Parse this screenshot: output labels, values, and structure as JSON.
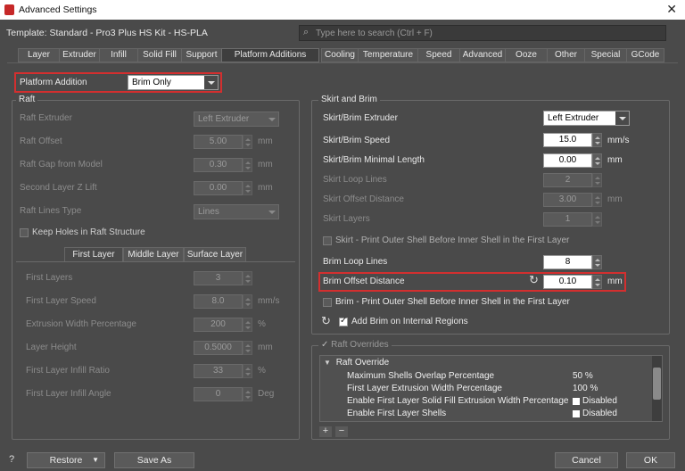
{
  "window": {
    "title": "Advanced Settings",
    "close_icon": "close-icon"
  },
  "header": {
    "template": "Template: Standard - Pro3 Plus HS Kit - HS-PLA",
    "search_placeholder": "Type here to search (Ctrl + F)"
  },
  "tabs": [
    "Layer",
    "Extruder",
    "Infill",
    "Solid Fill",
    "Support",
    "Platform Additions",
    "Cooling",
    "Temperature",
    "Speed",
    "Advanced",
    "Ooze",
    "Other",
    "Special",
    "GCode"
  ],
  "active_tab": "Platform Additions",
  "platform": {
    "label": "Platform Addition",
    "value": "Brim Only"
  },
  "raft": {
    "title": "Raft",
    "extruder": {
      "label": "Raft Extruder",
      "value": "Left Extruder"
    },
    "offset": {
      "label": "Raft Offset",
      "value": "5.00",
      "unit": "mm"
    },
    "gap": {
      "label": "Raft Gap from Model",
      "value": "0.30",
      "unit": "mm"
    },
    "second_z": {
      "label": "Second Layer Z Lift",
      "value": "0.00",
      "unit": "mm"
    },
    "lines_type": {
      "label": "Raft Lines Type",
      "value": "Lines"
    },
    "keep_holes": "Keep Holes in Raft Structure",
    "subtabs": [
      "First Layer",
      "Middle Layer",
      "Surface Layer"
    ],
    "first_layers": {
      "label": "First Layers",
      "value": "3"
    },
    "first_speed": {
      "label": "First Layer Speed",
      "value": "8.0",
      "unit": "mm/s"
    },
    "extrusion_width": {
      "label": "Extrusion Width Percentage",
      "value": "200",
      "unit": "%"
    },
    "layer_height": {
      "label": "Layer Height",
      "value": "0.5000",
      "unit": "mm"
    },
    "infill_ratio": {
      "label": "First Layer Infill Ratio",
      "value": "33",
      "unit": "%"
    },
    "infill_angle": {
      "label": "First Layer Infill Angle",
      "value": "0",
      "unit": "Deg"
    }
  },
  "skirt": {
    "title": "Skirt and Brim",
    "extruder": {
      "label": "Skirt/Brim Extruder",
      "value": "Left Extruder"
    },
    "speed": {
      "label": "Skirt/Brim Speed",
      "value": "15.0",
      "unit": "mm/s"
    },
    "min_length": {
      "label": "Skirt/Brim Minimal Length",
      "value": "0.00",
      "unit": "mm"
    },
    "loop_lines": {
      "label": "Skirt Loop Lines",
      "value": "2"
    },
    "offset": {
      "label": "Skirt Offset Distance",
      "value": "3.00",
      "unit": "mm"
    },
    "layers": {
      "label": "Skirt Layers",
      "value": "1"
    },
    "outer_shell": "Skirt - Print Outer Shell Before Inner Shell in the First Layer",
    "brim_loops": {
      "label": "Brim Loop Lines",
      "value": "8"
    },
    "brim_offset": {
      "label": "Brim Offset Distance",
      "value": "0.10",
      "unit": "mm"
    },
    "brim_outer": "Brim - Print Outer Shell Before Inner Shell in the First Layer",
    "add_brim": "Add Brim on Internal Regions"
  },
  "raft_overrides": {
    "title": "Raft Overrides",
    "group": "Raft Override",
    "rows": [
      {
        "name": "Maximum Shells Overlap Percentage",
        "value": "50 %"
      },
      {
        "name": "First Layer Extrusion Width Percentage",
        "value": "100 %"
      },
      {
        "name": "Enable First Layer Solid Fill Extrusion Width Percentage",
        "value": "Disabled"
      },
      {
        "name": "Enable First Layer Shells",
        "value": "Disabled"
      }
    ]
  },
  "footer": {
    "restore": "Restore",
    "save_as": "Save As",
    "cancel": "Cancel",
    "ok": "OK"
  }
}
